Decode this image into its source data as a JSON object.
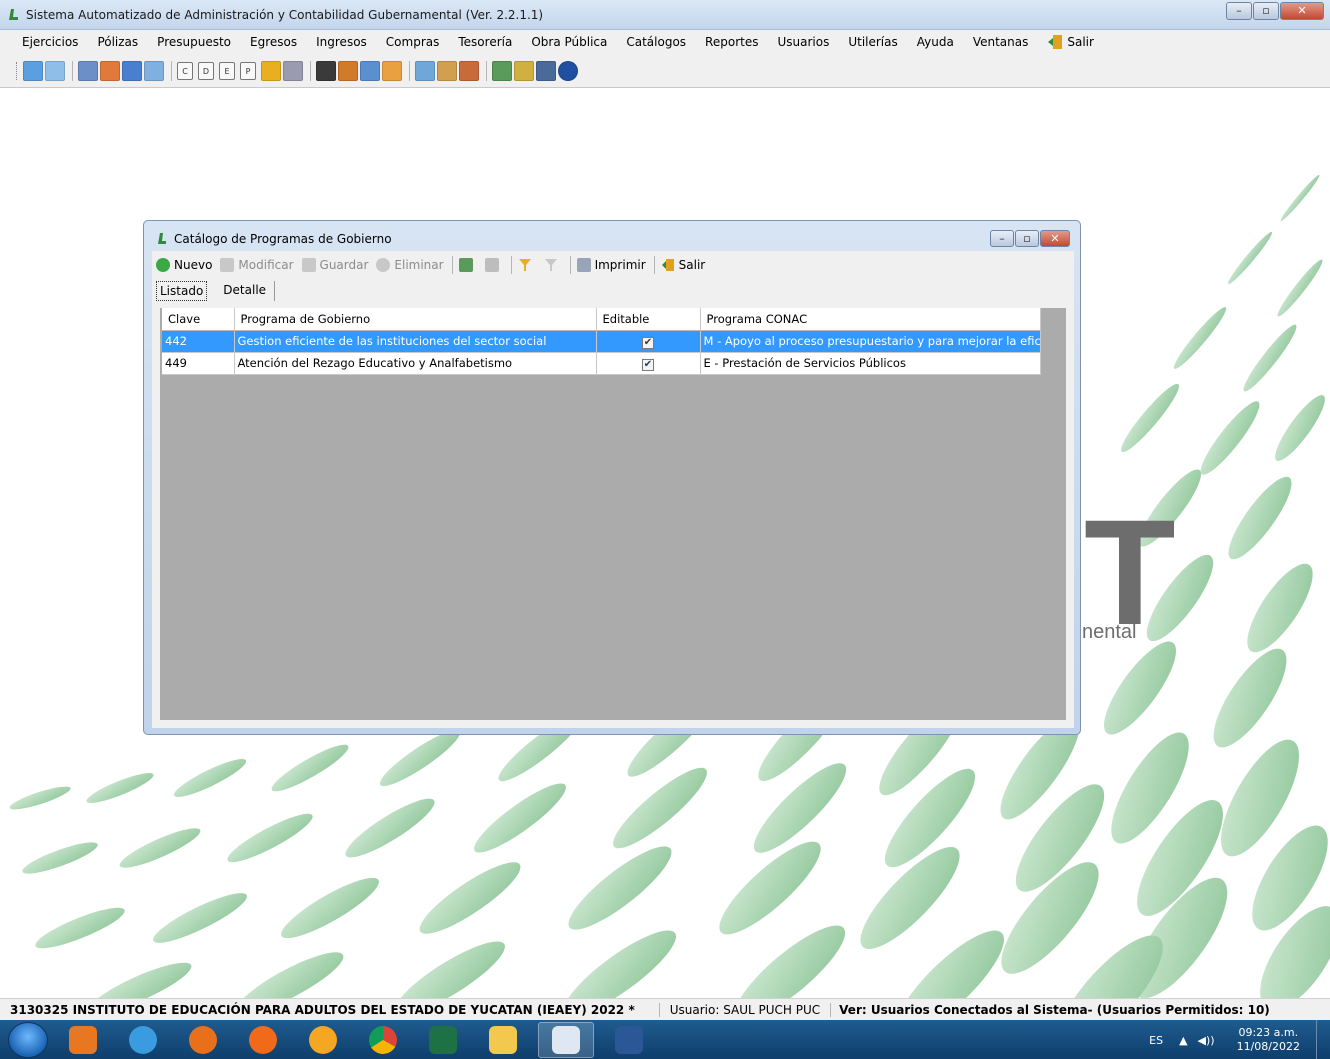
{
  "window": {
    "title": "Sistema Automatizado de Administración y Contabilidad Gubernamental  (Ver. 2.2.1.1)",
    "controls": {
      "minimize": "–",
      "maximize": "▫",
      "close": "✕"
    }
  },
  "menu": {
    "items": [
      "Ejercicios",
      "Pólizas",
      "Presupuesto",
      "Egresos",
      "Ingresos",
      "Compras",
      "Tesorería",
      "Obra Pública",
      "Catálogos",
      "Reportes",
      "Usuarios",
      "Utilerías",
      "Ayuda",
      "Ventanas",
      "Salir"
    ]
  },
  "toolbar": {
    "letters": [
      "C",
      "D",
      "E",
      "P"
    ]
  },
  "background": {
    "watermark_letter": "T",
    "watermark_text": "nental"
  },
  "child": {
    "title": "Catálogo de Programas de Gobierno",
    "controls": {
      "minimize": "–",
      "maximize": "▫",
      "close": "✕"
    },
    "toolbar": {
      "nuevo": "Nuevo",
      "modificar": "Modificar",
      "guardar": "Guardar",
      "eliminar": "Eliminar",
      "imprimir": "Imprimir",
      "salir": "Salir"
    },
    "tabs": [
      "Listado",
      "Detalle"
    ],
    "grid": {
      "columns": [
        "Clave",
        "Programa de Gobierno",
        "Editable",
        "Programa CONAC"
      ],
      "rows": [
        {
          "clave": "442",
          "programa": "Gestion eficiente de las instituciones del sector social",
          "editable": true,
          "conac": "M - Apoyo al proceso presupuestario y para mejorar la eficiencia in..."
        },
        {
          "clave": "449",
          "programa": "Atención del Rezago Educativo y Analfabetismo",
          "editable": true,
          "conac": "E - Prestación de Servicios Públicos"
        }
      ],
      "selected_row": 0
    }
  },
  "status": {
    "entity": "3130325 INSTITUTO DE EDUCACIÓN PARA ADULTOS DEL ESTADO DE YUCATAN (IEAEY)  2022   *",
    "user": "Usuario: SAUL PUCH PUC",
    "connected": "Ver: Usuarios Conectados al Sistema",
    "permitted": " - (Usuarios Permitidos: 10)"
  },
  "taskbar": {
    "tray": {
      "lang": "ES",
      "arrow": "▲",
      "volume": "◀))",
      "time": "09:23 a.m.",
      "date": "11/08/2022"
    }
  },
  "colors": {
    "selection": "#3399ff",
    "brand_green": "#2e8b3a",
    "watermark_green": "#8fc99a"
  }
}
